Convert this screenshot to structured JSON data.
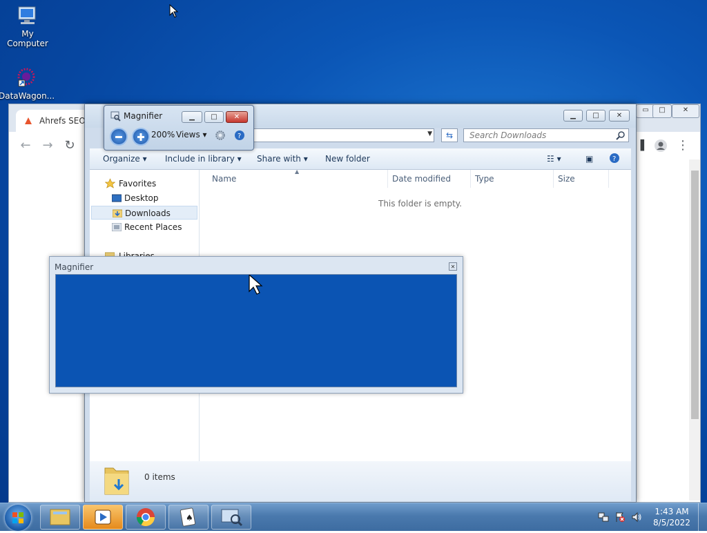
{
  "desktop": {
    "icons": [
      {
        "label": "My Computer",
        "icon": "computer-icon"
      },
      {
        "label": "DataWagon...",
        "icon": "datawagon-icon"
      }
    ]
  },
  "chrome": {
    "tab_title": "Ahrefs SEO T"
  },
  "explorer": {
    "search_placeholder": "Search Downloads",
    "toolbar": {
      "organize": "Organize",
      "include_in_library": "Include in library",
      "share_with": "Share with",
      "new_folder": "New folder"
    },
    "nav": {
      "favorites": "Favorites",
      "desktop": "Desktop",
      "downloads": "Downloads",
      "recent_places": "Recent Places",
      "libraries": "Libraries"
    },
    "columns": {
      "name": "Name",
      "date_modified": "Date modified",
      "type": "Type",
      "size": "Size"
    },
    "empty_message": "This folder is empty.",
    "item_count": "0 items"
  },
  "magnifier": {
    "title": "Magnifier",
    "zoom": "200%",
    "views_label": "Views",
    "lens_title": "Magnifier"
  },
  "taskbar": {
    "apps": [
      "windows-explorer-icon",
      "media-center-icon",
      "chrome-icon",
      "solitaire-icon",
      "magnifier-icon"
    ],
    "time": "1:43 AM",
    "date": "8/5/2022"
  },
  "colors": {
    "desktop": "#0b56b6",
    "accent": "#2a6bc4",
    "close_red": "#c7372f"
  }
}
